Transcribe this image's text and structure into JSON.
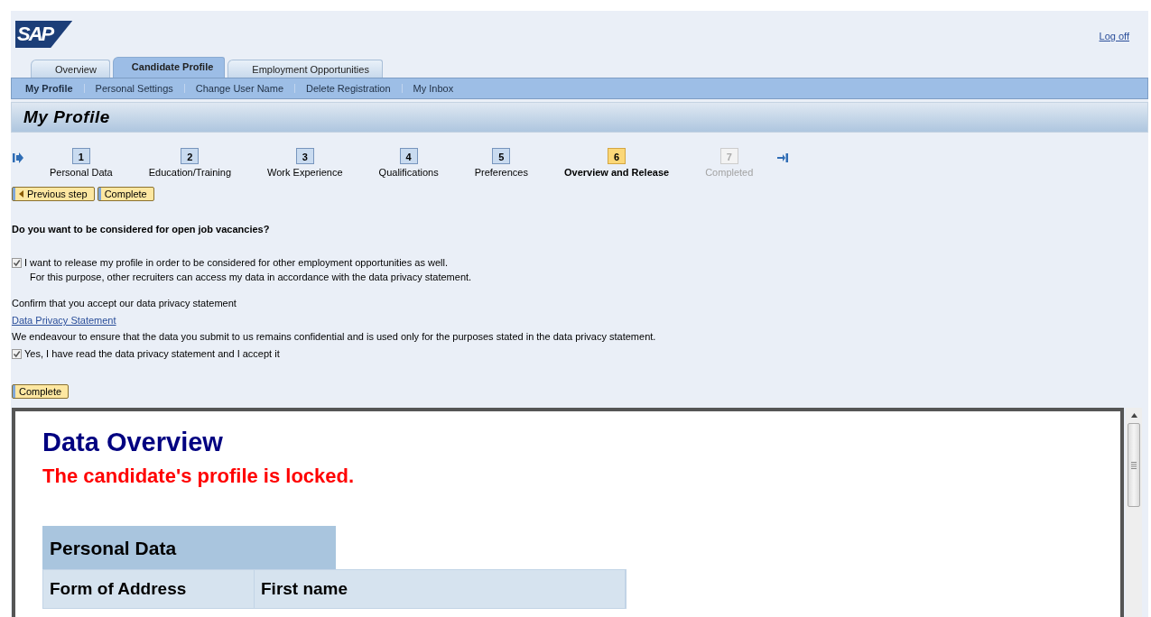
{
  "header": {
    "logo": "SAP",
    "logoff": "Log off"
  },
  "tabs": [
    {
      "label": "Overview",
      "selected": false
    },
    {
      "label": "Candidate Profile",
      "selected": true
    },
    {
      "label": "Employment Opportunities",
      "selected": false
    }
  ],
  "subnav": [
    {
      "label": "My Profile",
      "selected": true
    },
    {
      "label": "Personal Settings",
      "selected": false
    },
    {
      "label": "Change User Name",
      "selected": false
    },
    {
      "label": "Delete Registration",
      "selected": false
    },
    {
      "label": "My Inbox",
      "selected": false
    }
  ],
  "page_title": "My Profile",
  "steps": [
    {
      "number": "1",
      "label": "Personal Data",
      "selected": false,
      "disabled": false
    },
    {
      "number": "2",
      "label": "Education/Training",
      "selected": false,
      "disabled": false
    },
    {
      "number": "3",
      "label": "Work Experience",
      "selected": false,
      "disabled": false
    },
    {
      "number": "4",
      "label": "Qualifications",
      "selected": false,
      "disabled": false
    },
    {
      "number": "5",
      "label": "Preferences",
      "selected": false,
      "disabled": false
    },
    {
      "number": "6",
      "label": "Overview and Release",
      "selected": true,
      "disabled": false
    },
    {
      "number": "7",
      "label": "Completed",
      "selected": false,
      "disabled": true
    }
  ],
  "top_buttons": [
    {
      "label": "Previous step",
      "kind": "back"
    },
    {
      "label": "Complete",
      "kind": "plain"
    }
  ],
  "question": "Do you want to be considered for open job vacancies?",
  "release": {
    "label": "I want to release my profile in order to be considered for other employment opportunities as well.",
    "note": "For this purpose, other recruiters can access my data in accordance with the data privacy statement.",
    "checked": true
  },
  "privacy": {
    "prompt": "Confirm that you accept our data privacy statement",
    "link": "Data Privacy Statement",
    "text": "We endeavour to ensure that the data you submit to us remains confidential and is used only for the purposes stated in the data privacy statement.",
    "accept_label": "Yes, I have read the data privacy statement and I accept it",
    "checked": true
  },
  "bottom_button": "Complete",
  "overview": {
    "title": "Data Overview",
    "status": "The candidate's profile is locked.",
    "section": "Personal Data",
    "columns": [
      "Form of Address",
      "First name"
    ]
  }
}
